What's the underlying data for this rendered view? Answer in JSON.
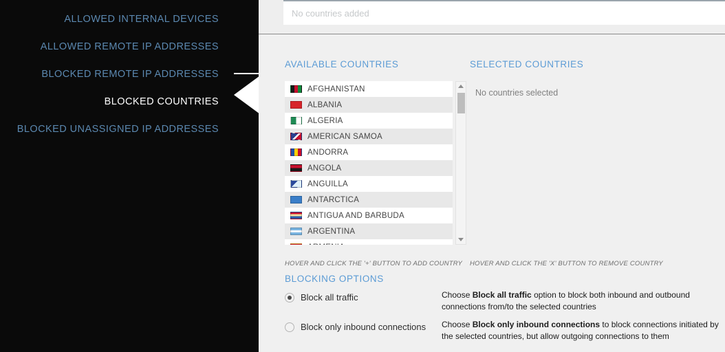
{
  "sidebar": {
    "items": [
      {
        "label": "ALLOWED INTERNAL DEVICES",
        "active": false
      },
      {
        "label": "ALLOWED REMOTE IP ADDRESSES",
        "active": false
      },
      {
        "label": "BLOCKED REMOTE IP ADDRESSES",
        "active": false
      },
      {
        "label": "BLOCKED COUNTRIES",
        "active": true
      },
      {
        "label": "BLOCKED UNASSIGNED IP ADDRESSES",
        "active": false
      }
    ]
  },
  "added_field": {
    "placeholder": "No countries added",
    "value": ""
  },
  "available": {
    "heading": "AVAILABLE COUNTRIES",
    "hint": "HOVER AND CLICK THE '+' BUTTON TO ADD COUNTRY",
    "countries": [
      {
        "name": "AFGHANISTAN",
        "flag": "linear-gradient(90deg,#1a1a1a 33%,#c8102e 33%,#c8102e 66%,#0f8a3c 66%)"
      },
      {
        "name": "ALBANIA",
        "flag": "linear-gradient(90deg,#d7242a 0%,#d7242a 100%)"
      },
      {
        "name": "ALGERIA",
        "flag": "linear-gradient(90deg,#1f8a54 50%,#ffffff 50%)"
      },
      {
        "name": "AMERICAN SAMOA",
        "flag": "linear-gradient(135deg,#2a3f8f 45%,#ffffff 45%,#ffffff 60%,#c8102e 60%)"
      },
      {
        "name": "ANDORRA",
        "flag": "linear-gradient(90deg,#2050a8 33%,#ffd000 33%,#ffd000 66%,#c8102e 66%)"
      },
      {
        "name": "ANGOLA",
        "flag": "linear-gradient(180deg,#c8102e 50%,#1a1a1a 50%)"
      },
      {
        "name": "ANGUILLA",
        "flag": "linear-gradient(135deg,#2a4a9c 40%,#dff0f8 40%)"
      },
      {
        "name": "ANTARCTICA",
        "flag": "linear-gradient(90deg,#3a7ec8 0%,#3a7ec8 100%)"
      },
      {
        "name": "ANTIGUA AND BARBUDA",
        "flag": "linear-gradient(180deg,#c8102e 30%,#f0e0a0 30%,#f0e0a0 60%,#2a5aa8 60%)"
      },
      {
        "name": "ARGENTINA",
        "flag": "linear-gradient(180deg,#79b4e0 33%,#ffffff 33%,#ffffff 66%,#79b4e0 66%)"
      },
      {
        "name": "ARMENIA",
        "flag": "linear-gradient(180deg,#d02b3c 33%,#2a4a9c 33%,#2a4a9c 66%,#f0a830 66%)"
      }
    ]
  },
  "selected": {
    "heading": "SELECTED COUNTRIES",
    "empty_text": "No countries selected",
    "hint": "HOVER AND CLICK THE 'X' BUTTON TO REMOVE COUNTRY",
    "countries": []
  },
  "blocking_options": {
    "heading": "BLOCKING OPTIONS",
    "options": [
      {
        "label": "Block all traffic",
        "selected": true
      },
      {
        "label": "Block only inbound connections",
        "selected": false
      }
    ],
    "descriptions": [
      {
        "prefix": "Choose ",
        "bold": "Block all traffic",
        "suffix": " option to block both inbound and outbound connections from/to the selected countries"
      },
      {
        "prefix": "Choose ",
        "bold": "Block only inbound connections",
        "suffix": " to block connections initiated by the selected countries, but allow outgoing connections to them"
      }
    ]
  },
  "colors": {
    "sidebar_bg": "#0a0a0a",
    "nav_link": "#5b88b0",
    "nav_active": "#ffffff",
    "heading_blue": "#5b9bd5",
    "content_bg": "#f0f0f0"
  }
}
